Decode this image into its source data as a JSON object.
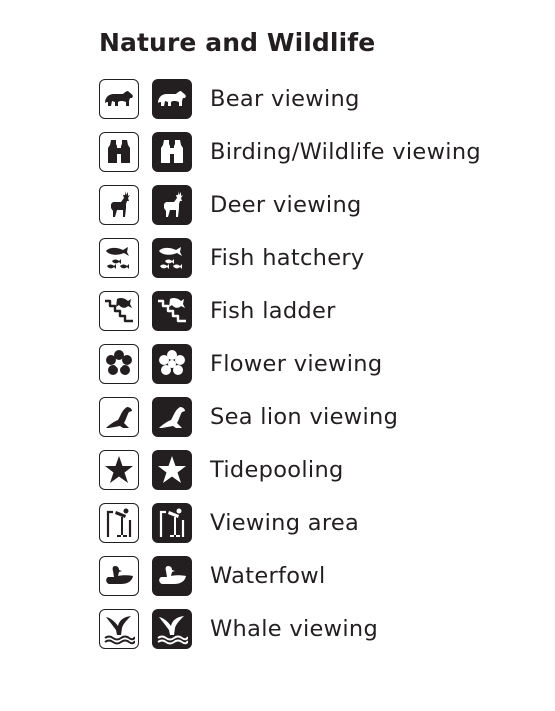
{
  "title": "Nature and Wildlife",
  "items": [
    {
      "label": "Bear viewing",
      "icon": "bear-icon"
    },
    {
      "label": "Birding/Wildlife viewing",
      "icon": "binoculars-icon"
    },
    {
      "label": "Deer viewing",
      "icon": "deer-icon"
    },
    {
      "label": "Fish hatchery",
      "icon": "fish-hatchery-icon"
    },
    {
      "label": "Fish ladder",
      "icon": "fish-ladder-icon"
    },
    {
      "label": "Flower viewing",
      "icon": "flower-icon"
    },
    {
      "label": "Sea lion viewing",
      "icon": "sea-lion-icon"
    },
    {
      "label": "Tidepooling",
      "icon": "starfish-icon"
    },
    {
      "label": "Viewing area",
      "icon": "viewing-area-icon"
    },
    {
      "label": "Waterfowl",
      "icon": "duck-icon"
    },
    {
      "label": "Whale viewing",
      "icon": "whale-tail-icon"
    }
  ],
  "colors": {
    "ink": "#231f20",
    "background": "#ffffff"
  }
}
